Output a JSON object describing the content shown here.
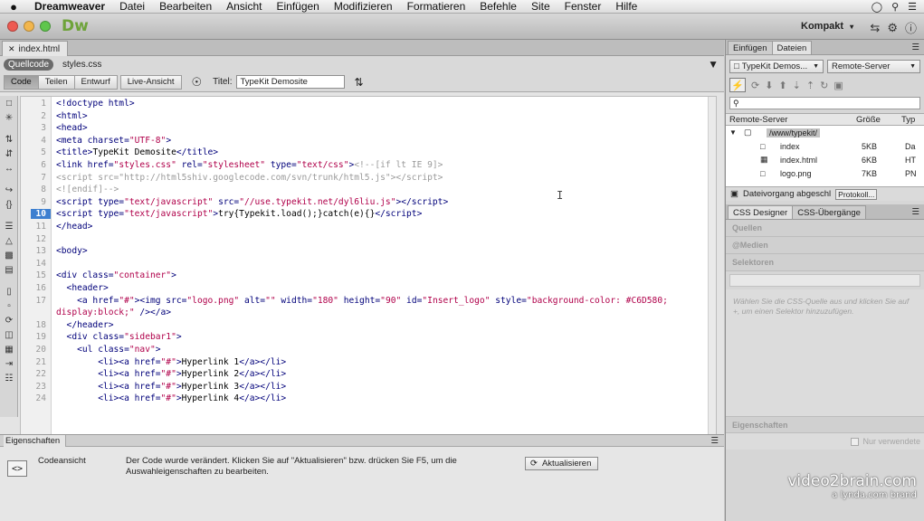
{
  "menubar": {
    "apple": "",
    "items": [
      "Dreamweaver",
      "Datei",
      "Bearbeiten",
      "Ansicht",
      "Einfügen",
      "Modifizieren",
      "Formatieren",
      "Befehle",
      "Site",
      "Fenster",
      "Hilfe"
    ]
  },
  "appbar": {
    "logo": "Dw",
    "workspace": "Kompakt",
    "traffic_colors": [
      "#ee5a52",
      "#f2b64d",
      "#5fc64c"
    ]
  },
  "document": {
    "tab_label": "index.html",
    "related": {
      "source": "Quellcode",
      "files": [
        "styles.css"
      ]
    },
    "views": [
      "Code",
      "Teilen",
      "Entwurf",
      "Live-Ansicht"
    ],
    "active_view": "Code",
    "title_label": "Titel:",
    "title_value": "TypeKit Demosite"
  },
  "code": {
    "current_line": 10,
    "lines": [
      {
        "n": "1",
        "html": "&lt;!doctype html&gt;"
      },
      {
        "n": "2",
        "html": "&lt;html&gt;"
      },
      {
        "n": "3",
        "html": "&lt;head&gt;"
      },
      {
        "n": "4",
        "html": "&lt;meta charset=<span class='str'>\"UTF-8\"</span>&gt;"
      },
      {
        "n": "5",
        "html": "&lt;title&gt;<span class='txt'>TypeKit Demosite</span>&lt;/title&gt;"
      },
      {
        "n": "6",
        "html": "&lt;link href=<span class='str'>\"styles.css\"</span> rel=<span class='str'>\"stylesheet\"</span> type=<span class='str'>\"text/css\"</span>&gt;<span class='cmt'>&lt;!--[if lt IE 9]&gt;</span>"
      },
      {
        "n": "7",
        "html": "<span class='cmt'>&lt;script src=\"http://html5shiv.googlecode.com/svn/trunk/html5.js\"&gt;&lt;/script&gt;</span>"
      },
      {
        "n": "8",
        "html": "<span class='cmt'>&lt;![endif]--&gt;</span>"
      },
      {
        "n": "9",
        "html": "&lt;script type=<span class='str'>\"text/javascript\"</span> src=<span class='str'>\"//use.typekit.net/dyl6liu.js\"</span>&gt;&lt;/script&gt;"
      },
      {
        "n": "10",
        "html": "&lt;script type=<span class='str'>\"text/javascript\"</span>&gt;<span class='txt'>try{Typekit.load();}catch(e){}</span>&lt;/script&gt;"
      },
      {
        "n": "11",
        "html": "&lt;/head&gt;"
      },
      {
        "n": "12",
        "html": ""
      },
      {
        "n": "13",
        "html": "&lt;body&gt;"
      },
      {
        "n": "14",
        "html": ""
      },
      {
        "n": "15",
        "html": "&lt;div class=<span class='str'>\"container\"</span>&gt;"
      },
      {
        "n": "16",
        "html": "  &lt;header&gt;"
      },
      {
        "n": "17",
        "html": "    &lt;a href=<span class='str'>\"#\"</span>&gt;&lt;img src=<span class='str'>\"logo.png\"</span> alt=<span class='str'>\"\"</span> width=<span class='str'>\"180\"</span> height=<span class='str'>\"90\"</span> id=<span class='str'>\"Insert_logo\"</span> style=<span class='str'>\"background-color: #C6D580;</span>"
      },
      {
        "n": "",
        "html": "<span class='str'>display:block;\"</span> /&gt;&lt;/a&gt;"
      },
      {
        "n": "18",
        "html": "  &lt;/header&gt;"
      },
      {
        "n": "19",
        "html": "  &lt;div class=<span class='str'>\"sidebar1\"</span>&gt;"
      },
      {
        "n": "20",
        "html": "    &lt;ul class=<span class='str'>\"nav\"</span>&gt;"
      },
      {
        "n": "21",
        "html": "        &lt;li&gt;&lt;a href=<span class='str'>\"#\"</span>&gt;<span class='txt'>Hyperlink 1</span>&lt;/a&gt;&lt;/li&gt;"
      },
      {
        "n": "22",
        "html": "        &lt;li&gt;&lt;a href=<span class='str'>\"#\"</span>&gt;<span class='txt'>Hyperlink 2</span>&lt;/a&gt;&lt;/li&gt;"
      },
      {
        "n": "23",
        "html": "        &lt;li&gt;&lt;a href=<span class='str'>\"#\"</span>&gt;<span class='txt'>Hyperlink 3</span>&lt;/a&gt;&lt;/li&gt;"
      },
      {
        "n": "24",
        "html": "        &lt;li&gt;&lt;a href=<span class='str'>\"#\"</span>&gt;<span class='txt'>Hyperlink 4</span>&lt;/a&gt;&lt;/li&gt;"
      }
    ]
  },
  "properties": {
    "tab": "Eigenschaften",
    "codeview_label": "Codeansicht",
    "message": "Der Code wurde verändert. Klicken Sie auf \"Aktualisieren\" bzw. drücken Sie F5, um die Auswahleigenschaften zu bearbeiten.",
    "refresh_button": "Aktualisieren"
  },
  "files_panel": {
    "tabs": [
      "Einfügen",
      "Dateien"
    ],
    "active_tab": "Dateien",
    "site_select": "TypeKit Demos...",
    "server_select": "Remote-Server",
    "columns": [
      "Remote-Server",
      "Größe",
      "Typ"
    ],
    "folder": "/www/typekit/",
    "files": [
      {
        "name": "index",
        "size": "5KB",
        "type": "Da"
      },
      {
        "name": "index.html",
        "size": "6KB",
        "type": "HT"
      },
      {
        "name": "logo.png",
        "size": "7KB",
        "type": "PN"
      }
    ],
    "status": "Dateivorgang abgeschl",
    "log_button": "Protokoll..."
  },
  "css_panel": {
    "tabs": [
      "CSS Designer",
      "CSS-Übergänge"
    ],
    "active_tab": "CSS Designer",
    "sections": [
      "Quellen",
      "@Medien",
      "Selektoren"
    ],
    "hint": "Wählen Sie die CSS-Quelle aus und klicken Sie auf +, um einen Selektor hinzuzufügen.",
    "properties_label": "Eigenschaften",
    "only_set_label": "Nur verwendete"
  },
  "watermark": {
    "line1": "video2brain.com",
    "line2": "a lynda.com brand"
  }
}
